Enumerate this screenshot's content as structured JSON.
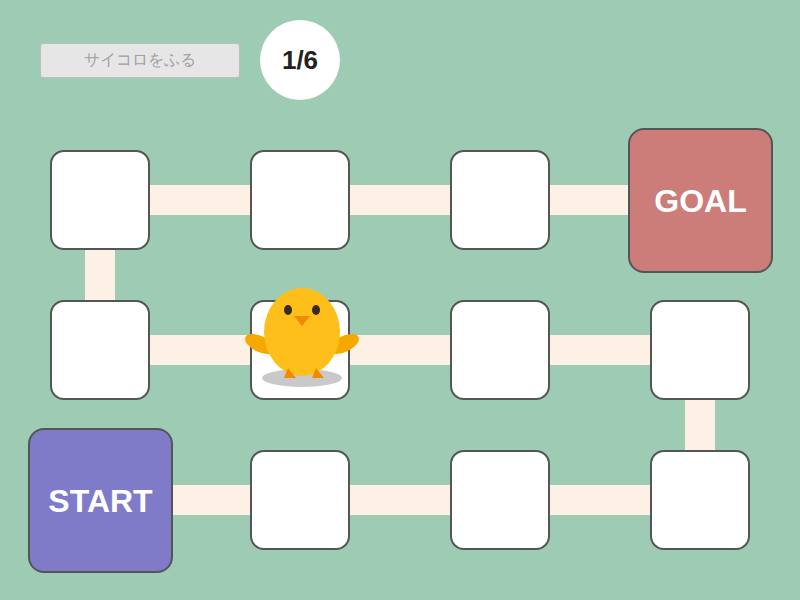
{
  "dice_button": {
    "label": "サイコロをふる",
    "disabled": true
  },
  "dice_result": "1/6",
  "board": {
    "cells": [
      {
        "kind": "start",
        "label": "START",
        "current": false
      },
      {
        "kind": "blank",
        "current": false
      },
      {
        "kind": "blank",
        "current": false
      },
      {
        "kind": "blank",
        "current": false
      },
      {
        "kind": "blank",
        "current": false
      },
      {
        "kind": "blank",
        "current": false
      },
      {
        "kind": "blank",
        "current": true
      },
      {
        "kind": "blank",
        "current": false
      },
      {
        "kind": "blank",
        "current": false
      },
      {
        "kind": "blank",
        "current": false
      },
      {
        "kind": "blank",
        "current": false
      },
      {
        "kind": "goal",
        "label": "GOAL",
        "current": false
      }
    ]
  }
}
